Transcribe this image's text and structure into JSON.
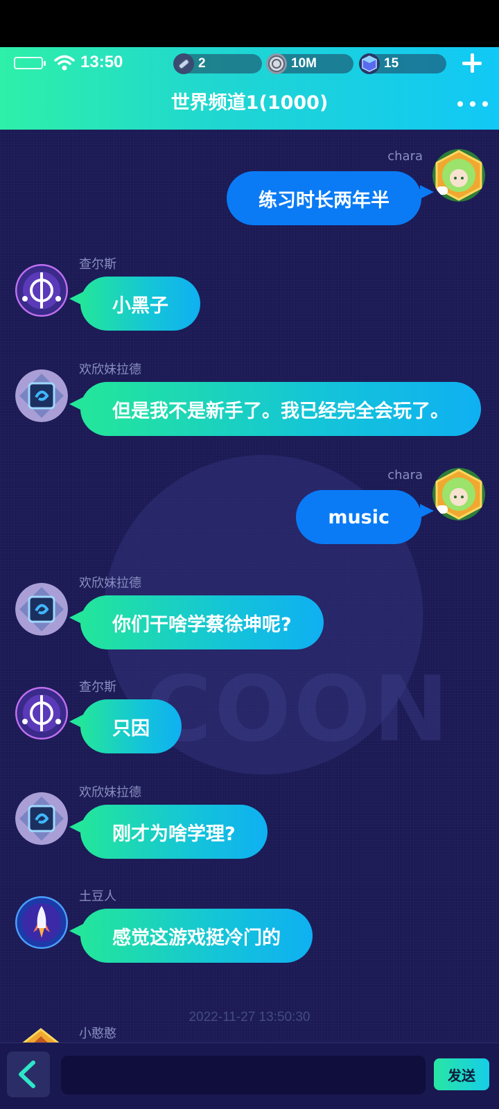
{
  "status_bar": {
    "time": "13:50",
    "battery_icon": "battery-empty-icon",
    "wifi_icon": "wifi-icon"
  },
  "currencies": [
    {
      "icon": "stamina-ticket-icon",
      "value": "2"
    },
    {
      "icon": "coin-icon",
      "value": "10M"
    },
    {
      "icon": "gem-cube-icon",
      "value": "15"
    }
  ],
  "header": {
    "title": "世界频道1(1000)",
    "add_icon": "plus-icon",
    "more_icon": "more-dots-icon"
  },
  "messages": [
    {
      "side": "right",
      "sender": "chara",
      "text": "练习时长两年半",
      "avatar": "green-hair-girl-avatar"
    },
    {
      "side": "left",
      "sender": "查尔斯",
      "text": "小黑子",
      "avatar": "purple-emblem-avatar"
    },
    {
      "side": "left",
      "sender": "欢欣妹拉德",
      "text": "但是我不是新手了。我已经完全会玩了。",
      "avatar": "blue-swirl-avatar"
    },
    {
      "side": "right",
      "sender": "chara",
      "text": "music",
      "avatar": "green-hair-girl-avatar"
    },
    {
      "side": "left",
      "sender": "欢欣妹拉德",
      "text": "你们干啥学蔡徐坤呢?",
      "avatar": "blue-swirl-avatar"
    },
    {
      "side": "left",
      "sender": "查尔斯",
      "text": "只因",
      "avatar": "purple-emblem-avatar"
    },
    {
      "side": "left",
      "sender": "欢欣妹拉德",
      "text": "刚才为啥学理?",
      "avatar": "blue-swirl-avatar"
    },
    {
      "side": "left",
      "sender": "土豆人",
      "text": "感觉这游戏挺冷门的",
      "avatar": "rocket-avatar"
    }
  ],
  "timestamp": "2022-11-27 13:50:30",
  "partial_message": {
    "sender": "小憨憨",
    "avatar": "orange-house-avatar"
  },
  "watermark": "COON",
  "input_bar": {
    "back_icon": "chevron-left-icon",
    "input_value": "",
    "send_label": "发送"
  }
}
